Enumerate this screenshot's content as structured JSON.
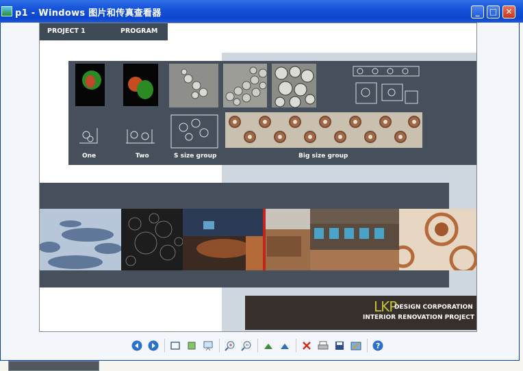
{
  "window": {
    "title": "p1 - Windows 图片和传真查看器",
    "min_label": "_",
    "max_label": "□",
    "close_label": "✕"
  },
  "slide": {
    "header": {
      "project": "PROJECT 1",
      "program": "PROGRAM"
    },
    "labels": {
      "one": "One",
      "two": "Two",
      "s_group": "S size group",
      "big_group": "Big size group"
    },
    "logo": {
      "letters": "LKP",
      "line1": "DESIGN CORPORATION",
      "line2": "INTERIOR RENOVATION PROJECT"
    },
    "colors": {
      "dark_panel": "#46505d",
      "light_panel": "#cfd7e0",
      "logo_bg": "#362f2b",
      "logo_accent": "#c7c237"
    }
  },
  "toolbar": {
    "icons": [
      "prev-image-icon",
      "next-image-icon",
      "best-fit-icon",
      "actual-size-icon",
      "slideshow-icon",
      "zoom-in-icon",
      "zoom-out-icon",
      "rotate-clockwise-icon",
      "rotate-counterclockwise-icon",
      "delete-icon",
      "print-icon",
      "save-icon",
      "edit-icon",
      "help-icon"
    ]
  }
}
